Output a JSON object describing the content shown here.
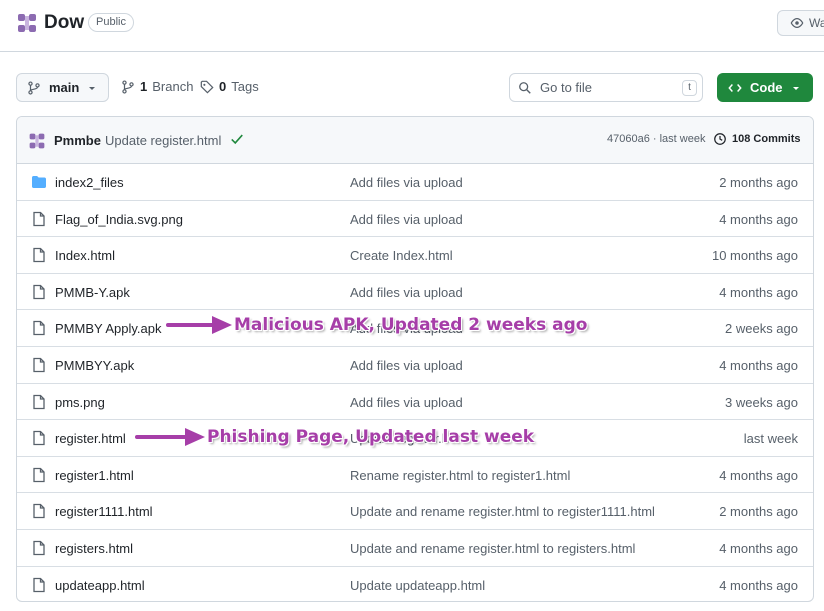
{
  "repo": {
    "name": "Dow",
    "visibility": "Public",
    "watch_label": "Wa"
  },
  "toolbar": {
    "branch": "main",
    "branch_count": "1",
    "branch_label": "Branch",
    "tag_count": "0",
    "tag_label": "Tags",
    "search_placeholder": "Go to file",
    "search_key": "t",
    "code_label": "Code"
  },
  "commit": {
    "author": "Pmmbe",
    "message": "Update register.html",
    "meta": "47060a6 · last week",
    "commits_label": "108 Commits"
  },
  "files": [
    {
      "name": "index2_files",
      "type": "folder",
      "message": "Add files via upload",
      "time": "2 months ago"
    },
    {
      "name": "Flag_of_India.svg.png",
      "type": "file",
      "message": "Add files via upload",
      "time": "4 months ago"
    },
    {
      "name": "Index.html",
      "type": "file",
      "message": "Create Index.html",
      "time": "10 months ago"
    },
    {
      "name": "PMMB-Y.apk",
      "type": "file",
      "message": "Add files via upload",
      "time": "4 months ago"
    },
    {
      "name": "PMMBY Apply.apk",
      "type": "file",
      "message": "Add files via upload",
      "time": "2 weeks ago"
    },
    {
      "name": "PMMBYY.apk",
      "type": "file",
      "message": "Add files via upload",
      "time": "4 months ago"
    },
    {
      "name": "pms.png",
      "type": "file",
      "message": "Add files via upload",
      "time": "3 weeks ago"
    },
    {
      "name": "register.html",
      "type": "file",
      "message": "Update register.html",
      "time": "last week"
    },
    {
      "name": "register1.html",
      "type": "file",
      "message": "Rename register.html to register1.html",
      "time": "4 months ago"
    },
    {
      "name": "register1111.html",
      "type": "file",
      "message": "Update and rename register.html to register1111.html",
      "time": "2 months ago"
    },
    {
      "name": "registers.html",
      "type": "file",
      "message": "Update and rename register.html to registers.html",
      "time": "4 months ago"
    },
    {
      "name": "updateapp.html",
      "type": "file",
      "message": "Update updateapp.html",
      "time": "4 months ago"
    }
  ],
  "annotations": {
    "apk": "Malicious APK, Updated 2 weeks ago",
    "phishing": "Phishing Page, Updated last week"
  },
  "colors": {
    "accent_green": "#1f883d",
    "annotation_purple": "#a63ea8",
    "folder_blue": "#54aeff",
    "logo_purple": "#8c6bb1"
  }
}
